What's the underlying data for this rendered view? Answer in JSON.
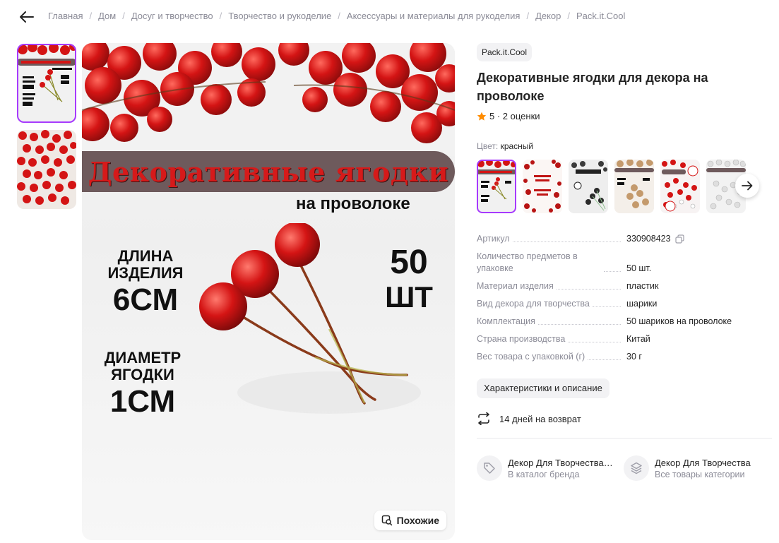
{
  "breadcrumbs": [
    "Главная",
    "Дом",
    "Досуг и творчество",
    "Творчество и рукоделие",
    "Аксессуары и материалы для рукоделия",
    "Декор",
    "Pack.it.Cool"
  ],
  "image": {
    "banner": "Декоративные ягодки",
    "subtitle": "на проволоке",
    "length_label_1": "ДЛИНА",
    "length_label_2": "ИЗДЕЛИЯ",
    "length_value": "6СМ",
    "count_value": "50",
    "count_unit": "ШТ",
    "diameter_label_1": "ДИАМЕТР",
    "diameter_label_2": "ЯГОДКИ",
    "diameter_value": "1СМ",
    "similar_button": "Похожие"
  },
  "product": {
    "brand": "Pack.it.Cool",
    "title": "Декоративные ягодки для декора на проволоке",
    "rating": "5",
    "reviews": "2 оценки",
    "rating_text": "5 · 2 оценки",
    "color_label": "Цвет:",
    "color_value": "красный"
  },
  "specs": [
    {
      "key": "Артикул",
      "value": "330908423"
    },
    {
      "key": "Количество предметов в упаковке",
      "value": "50 шт."
    },
    {
      "key": "Материал изделия",
      "value": "пластик"
    },
    {
      "key": "Вид декора для творчества",
      "value": "шарики"
    },
    {
      "key": "Комплектация",
      "value": "50 шариков на проволоке"
    },
    {
      "key": "Страна производства",
      "value": "Китай"
    },
    {
      "key": "Вес товара с упаковкой (г)",
      "value": "30 г"
    }
  ],
  "characteristics_button": "Характеристики и описание",
  "return_text": "14 дней на возврат",
  "links": [
    {
      "title": "Декор Для Творчества P...",
      "sub": "В каталог бренда"
    },
    {
      "title": "Декор Для Творчества",
      "sub": "Все товары категории"
    }
  ],
  "colors": {
    "accent": "#a73afd",
    "star": "#ff8c00",
    "berry": "#d41414",
    "banner": "#6e5a5c"
  }
}
